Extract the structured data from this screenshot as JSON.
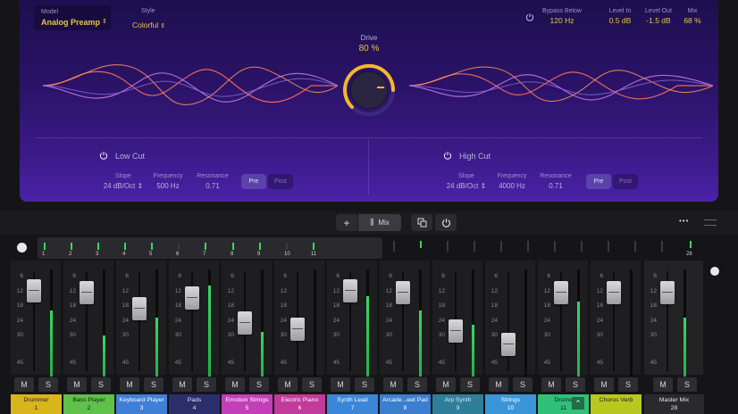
{
  "plugin": {
    "model_label": "Model",
    "model_value": "Analog Preamp",
    "style_label": "Style",
    "style_value": "Colorful",
    "bypass_label": "Bypass Below",
    "bypass_value": "120 Hz",
    "level_in_label": "Level In",
    "level_in_value": "0.5 dB",
    "level_out_label": "Level Out",
    "level_out_value": "-1.5 dB",
    "mix_label": "Mix",
    "mix_value": "68 %",
    "drive_label": "Drive",
    "drive_value": "80 %",
    "low_cut": {
      "title": "Low Cut",
      "slope_label": "Slope",
      "slope_value": "24 dB/Oct",
      "freq_label": "Frequency",
      "freq_value": "500 Hz",
      "res_label": "Resonance",
      "res_value": "0.71",
      "pre": "Pre",
      "post": "Post"
    },
    "high_cut": {
      "title": "High Cut",
      "slope_label": "Slope",
      "slope_value": "24 dB/Oct",
      "freq_label": "Frequency",
      "freq_value": "4000 Hz",
      "res_label": "Resonance",
      "res_value": "0.71",
      "pre": "Pre",
      "post": "Post"
    },
    "colors": {
      "accent": "#e6c34a",
      "panel": "#2a1266"
    }
  },
  "toolbar": {
    "add": "+",
    "mix_label": "Mix",
    "more": "•••"
  },
  "overview": {
    "numbers": [
      "1",
      "2",
      "3",
      "4",
      "5",
      "6",
      "7",
      "8",
      "9",
      "10",
      "11"
    ],
    "master_number": "28"
  },
  "scale": [
    "6",
    "12",
    "18",
    "24",
    "30",
    "45"
  ],
  "buttons": {
    "mute": "M",
    "solo": "S"
  },
  "channels": [
    {
      "name": "Drummer",
      "number": "1",
      "color": "#d9b51c",
      "level": 0.62
    },
    {
      "name": "Bass Player",
      "number": "2",
      "color": "#5fc04a",
      "level": 0.38
    },
    {
      "name": "Keyboard Player",
      "number": "3",
      "color": "#3f7fd8",
      "level": 0.55
    },
    {
      "name": "Pads",
      "number": "4",
      "color": "#2b2e6a",
      "level": 0.85
    },
    {
      "name": "Emotion Strings",
      "number": "5",
      "color": "#c23fb8",
      "level": 0.42
    },
    {
      "name": "Electric Piano",
      "number": "6",
      "color": "#c23a9a",
      "level": 0.0
    },
    {
      "name": "Synth Lead",
      "number": "7",
      "color": "#3a86d8",
      "level": 0.75
    },
    {
      "name": "Arcade...eet Pad",
      "number": "8",
      "color": "#3a7fd0",
      "level": 0.62
    },
    {
      "name": "Arp Synth",
      "number": "9",
      "color": "#2f7f9a",
      "level": 0.48
    },
    {
      "name": "Strings",
      "number": "10",
      "color": "#3a96d8",
      "level": 0.0
    },
    {
      "name": "Drums",
      "number": "11",
      "color": "#2fc07a",
      "level": 0.7
    },
    {
      "name": "Chorus Verb",
      "number": "",
      "color": "#b8c81f",
      "level": 0.0
    },
    {
      "name": "Master Mix",
      "number": "28",
      "color": "#2a2a2e",
      "level": 0.55
    }
  ]
}
